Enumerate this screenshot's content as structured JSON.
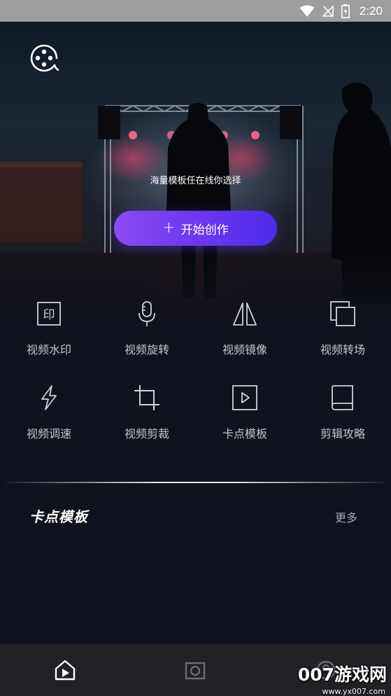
{
  "status_bar": {
    "time": "2:20",
    "icons": [
      "wifi-icon",
      "signal-off-icon",
      "battery-charging-icon"
    ]
  },
  "hero": {
    "logo_icon": "film-reel-icon",
    "subtitle": "海量模板任在线你选择",
    "start_button": {
      "icon": "+",
      "label": "开始创作"
    }
  },
  "tools": [
    {
      "label": "视频水印",
      "icon": "watermark-stamp-icon"
    },
    {
      "label": "视频旋转",
      "icon": "microphone-icon"
    },
    {
      "label": "视频镜像",
      "icon": "mirror-flip-icon"
    },
    {
      "label": "视频转场",
      "icon": "transition-layers-icon"
    },
    {
      "label": "视频调速",
      "icon": "lightning-icon"
    },
    {
      "label": "视频剪裁",
      "icon": "crop-icon"
    },
    {
      "label": "卡点模板",
      "icon": "play-box-icon"
    },
    {
      "label": "剪辑攻略",
      "icon": "book-icon"
    }
  ],
  "section": {
    "title": "卡点模板",
    "more": "更多"
  },
  "bottom_nav": [
    {
      "icon": "home-video-icon",
      "active": true
    },
    {
      "icon": "camera-icon",
      "active": false
    },
    {
      "icon": "profile-icon",
      "active": false
    }
  ],
  "watermark": {
    "text": "007游戏网",
    "url": "www.yx007.com"
  },
  "colors": {
    "background": "#10121d",
    "accent_start": "#8a4cf0",
    "accent_end": "#4d2ce8",
    "label": "#c4c6ce",
    "nav_bg": "#222127",
    "status_bar": "#9e9e9e"
  }
}
